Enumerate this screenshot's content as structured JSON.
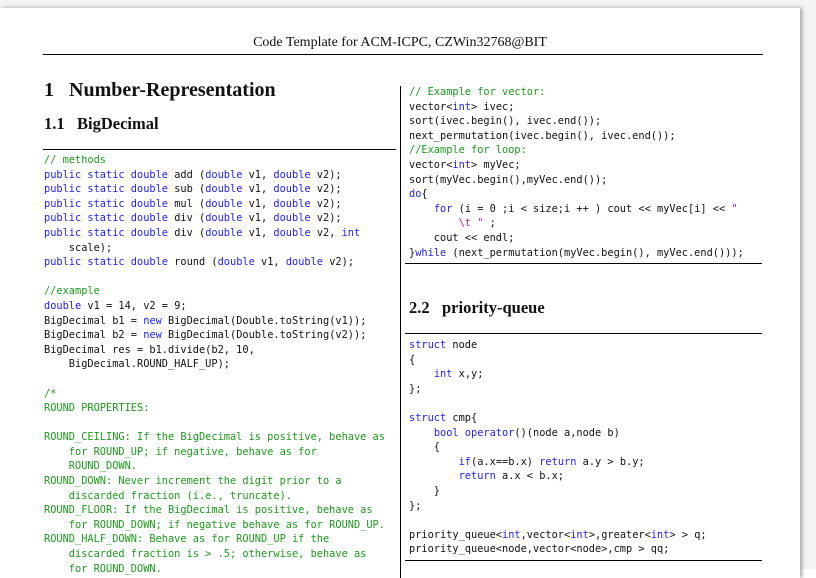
{
  "header": {
    "title": "Code Template for ACM-ICPC, CZWin32768@BIT"
  },
  "section": {
    "number": "1",
    "title": "Number-Representation"
  },
  "sub_bigdecimal": {
    "number": "1.1",
    "title": "BigDecimal"
  },
  "sub_pq": {
    "number": "2.2",
    "title": "priority-queue"
  },
  "left_code": [
    [
      {
        "c": "cm",
        "t": "// methods"
      }
    ],
    [
      {
        "c": "kw",
        "t": "public static double"
      },
      {
        "t": " add ("
      },
      {
        "c": "kw",
        "t": "double"
      },
      {
        "t": " v1, "
      },
      {
        "c": "kw",
        "t": "double"
      },
      {
        "t": " v2);"
      }
    ],
    [
      {
        "c": "kw",
        "t": "public static double"
      },
      {
        "t": " sub ("
      },
      {
        "c": "kw",
        "t": "double"
      },
      {
        "t": " v1, "
      },
      {
        "c": "kw",
        "t": "double"
      },
      {
        "t": " v2);"
      }
    ],
    [
      {
        "c": "kw",
        "t": "public static double"
      },
      {
        "t": " mul ("
      },
      {
        "c": "kw",
        "t": "double"
      },
      {
        "t": " v1, "
      },
      {
        "c": "kw",
        "t": "double"
      },
      {
        "t": " v2);"
      }
    ],
    [
      {
        "c": "kw",
        "t": "public static double"
      },
      {
        "t": " div ("
      },
      {
        "c": "kw",
        "t": "double"
      },
      {
        "t": " v1, "
      },
      {
        "c": "kw",
        "t": "double"
      },
      {
        "t": " v2);"
      }
    ],
    [
      {
        "c": "kw",
        "t": "public static double"
      },
      {
        "t": " div ("
      },
      {
        "c": "kw",
        "t": "double"
      },
      {
        "t": " v1, "
      },
      {
        "c": "kw",
        "t": "double"
      },
      {
        "t": " v2, "
      },
      {
        "c": "kw",
        "t": "int"
      }
    ],
    [
      {
        "t": "    scale);"
      }
    ],
    [
      {
        "c": "kw",
        "t": "public static double"
      },
      {
        "t": " round ("
      },
      {
        "c": "kw",
        "t": "double"
      },
      {
        "t": " v1, "
      },
      {
        "c": "kw",
        "t": "double"
      },
      {
        "t": " v2);"
      }
    ],
    [
      {
        "t": ""
      }
    ],
    [
      {
        "c": "cm",
        "t": "//example"
      }
    ],
    [
      {
        "c": "kw",
        "t": "double"
      },
      {
        "t": " v1 = 14, v2 = 9;"
      }
    ],
    [
      {
        "t": "BigDecimal b1 = "
      },
      {
        "c": "kw",
        "t": "new"
      },
      {
        "t": " BigDecimal(Double.toString(v1));"
      }
    ],
    [
      {
        "t": "BigDecimal b2 = "
      },
      {
        "c": "kw",
        "t": "new"
      },
      {
        "t": " BigDecimal(Double.toString(v2));"
      }
    ],
    [
      {
        "t": "BigDecimal res = b1.divide(b2, 10,"
      }
    ],
    [
      {
        "t": "    BigDecimal.ROUND_HALF_UP);"
      }
    ],
    [
      {
        "t": ""
      }
    ],
    [
      {
        "c": "cm",
        "t": "/*"
      }
    ],
    [
      {
        "c": "cm",
        "t": "ROUND PROPERTIES:"
      }
    ],
    [
      {
        "t": ""
      }
    ],
    [
      {
        "c": "cm",
        "t": "ROUND_CEILING: If the BigDecimal is positive, behave as"
      }
    ],
    [
      {
        "c": "cm",
        "t": "    for ROUND_UP; if negative, behave as for"
      }
    ],
    [
      {
        "c": "cm",
        "t": "    ROUND_DOWN."
      }
    ],
    [
      {
        "c": "cm",
        "t": "ROUND_DOWN: Never increment the digit prior to a"
      }
    ],
    [
      {
        "c": "cm",
        "t": "    discarded fraction (i.e., truncate)."
      }
    ],
    [
      {
        "c": "cm",
        "t": "ROUND_FLOOR: If the BigDecimal is positive, behave as"
      }
    ],
    [
      {
        "c": "cm",
        "t": "    for ROUND_DOWN; if negative behave as for ROUND_UP."
      }
    ],
    [
      {
        "c": "cm",
        "t": "ROUND_HALF_DOWN: Behave as for ROUND_UP if the"
      }
    ],
    [
      {
        "c": "cm",
        "t": "    discarded fraction is > .5; otherwise, behave as"
      }
    ],
    [
      {
        "c": "cm",
        "t": "    for ROUND_DOWN."
      }
    ]
  ],
  "right_code_top": [
    [
      {
        "c": "cm",
        "t": "// Example for vector:"
      }
    ],
    [
      {
        "t": "vector<"
      },
      {
        "c": "kw",
        "t": "int"
      },
      {
        "t": "> ivec;"
      }
    ],
    [
      {
        "t": "sort(ivec.begin(), ivec.end());"
      }
    ],
    [
      {
        "t": "next_permutation(ivec.begin(), ivec.end());"
      }
    ],
    [
      {
        "c": "cm",
        "t": "//Example for loop:"
      }
    ],
    [
      {
        "t": "vector<"
      },
      {
        "c": "kw",
        "t": "int"
      },
      {
        "t": "> myVec;"
      }
    ],
    [
      {
        "t": "sort(myVec.begin(),myVec.end());"
      }
    ],
    [
      {
        "c": "kw",
        "t": "do"
      },
      {
        "t": "{"
      }
    ],
    [
      {
        "t": "    "
      },
      {
        "c": "kw",
        "t": "for"
      },
      {
        "t": " (i = 0 ;i < size;i ++ ) cout << myVec[i] << "
      },
      {
        "c": "st",
        "t": "\""
      }
    ],
    [
      {
        "c": "st",
        "t": "        \\t \""
      },
      {
        "t": " ;"
      }
    ],
    [
      {
        "t": "    cout << endl;"
      }
    ],
    [
      {
        "t": "}"
      },
      {
        "c": "kw",
        "t": "while"
      },
      {
        "t": " (next_permutation(myVec.begin(), myVec.end()));"
      }
    ]
  ],
  "right_code_pq": [
    [
      {
        "c": "kw",
        "t": "struct"
      },
      {
        "t": " node"
      }
    ],
    [
      {
        "t": "{"
      }
    ],
    [
      {
        "t": "    "
      },
      {
        "c": "kw",
        "t": "int"
      },
      {
        "t": " x,y;"
      }
    ],
    [
      {
        "t": "};"
      }
    ],
    [
      {
        "t": ""
      }
    ],
    [
      {
        "c": "kw",
        "t": "struct"
      },
      {
        "t": " cmp{"
      }
    ],
    [
      {
        "t": "    "
      },
      {
        "c": "kw",
        "t": "bool operator"
      },
      {
        "t": "()(node a,node b)"
      }
    ],
    [
      {
        "t": "    {"
      }
    ],
    [
      {
        "t": "        "
      },
      {
        "c": "kw",
        "t": "if"
      },
      {
        "t": "(a.x==b.x) "
      },
      {
        "c": "kw",
        "t": "return"
      },
      {
        "t": " a.y > b.y;"
      }
    ],
    [
      {
        "t": "        "
      },
      {
        "c": "kw",
        "t": "return"
      },
      {
        "t": " a.x < b.x;"
      }
    ],
    [
      {
        "t": "    }"
      }
    ],
    [
      {
        "t": "};"
      }
    ],
    [
      {
        "t": ""
      }
    ],
    [
      {
        "t": "priority_queue<"
      },
      {
        "c": "kw",
        "t": "int"
      },
      {
        "t": ",vector<"
      },
      {
        "c": "kw",
        "t": "int"
      },
      {
        "t": ">,greater<"
      },
      {
        "c": "kw",
        "t": "int"
      },
      {
        "t": "> > q;"
      }
    ],
    [
      {
        "t": "priority_queue<node,vector<node>,cmp > qq;"
      }
    ]
  ]
}
